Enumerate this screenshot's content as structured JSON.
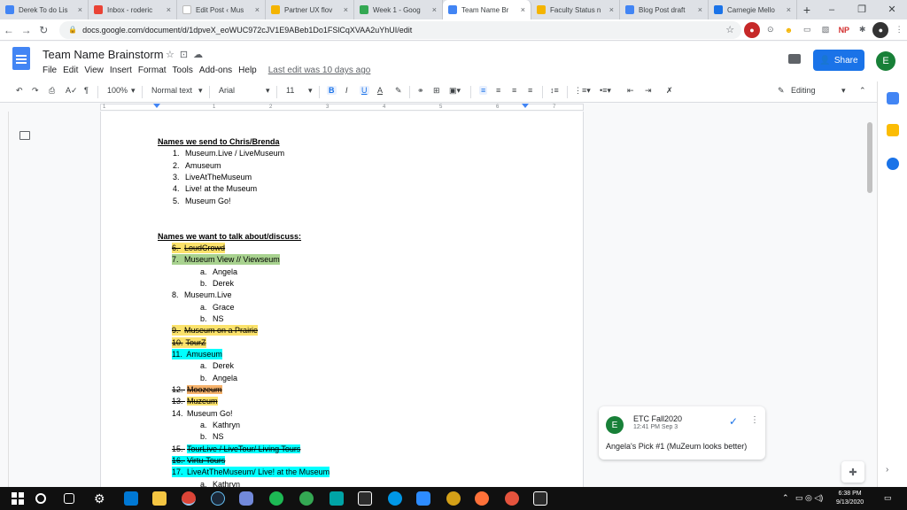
{
  "browser": {
    "tabs": [
      {
        "label": "Derek To do Lis",
        "color": "#4285f4",
        "active": false
      },
      {
        "label": "Inbox - roderic",
        "color": "#ea4335",
        "active": false
      },
      {
        "label": "Edit Post ‹ Mus",
        "color": "#ffffff",
        "active": false
      },
      {
        "label": "Partner UX flov",
        "color": "#f4b400",
        "active": false
      },
      {
        "label": "Week 1 - Goog",
        "color": "#34a853",
        "active": false
      },
      {
        "label": "Team Name Br",
        "color": "#4285f4",
        "active": true
      },
      {
        "label": "Faculty Status n",
        "color": "#f4b400",
        "active": false
      },
      {
        "label": "Blog Post draft",
        "color": "#4285f4",
        "active": false
      },
      {
        "label": "Carnegie Mello",
        "color": "#1a73e8",
        "active": false
      }
    ],
    "tab_close": "×",
    "new_tab": "+",
    "window_controls": {
      "minimize": "–",
      "restore": "❐",
      "close": "✕"
    },
    "url": "docs.google.com/document/d/1dpveX_eoWUC972cJV1E9ABeb1Do1FSlCqXVAA2uYhUI/edit",
    "extensions": [
      "NP"
    ]
  },
  "doc": {
    "title": "Team Name Brainstorm",
    "menu": [
      "File",
      "Edit",
      "View",
      "Insert",
      "Format",
      "Tools",
      "Add-ons",
      "Help"
    ],
    "last_edit": "Last edit was 10 days ago",
    "share_label": "Share",
    "user_initial": "E"
  },
  "toolbar": {
    "zoom": "100%",
    "style": "Normal text",
    "font": "Arial",
    "size": "11",
    "bold": "B",
    "italic": "I",
    "underline": "U",
    "text_color": "A",
    "mode": "Editing"
  },
  "ruler": {
    "numbers": [
      "1",
      "1",
      "2",
      "3",
      "4",
      "5",
      "6",
      "7"
    ]
  },
  "content": {
    "section1_header": "Names we send to Chris/Brenda",
    "section1": [
      {
        "n": "1.",
        "text": "Museum.Live / LiveMuseum"
      },
      {
        "n": "2.",
        "text": "Amuseum"
      },
      {
        "n": "3.",
        "text": "LiveAtTheMuseum"
      },
      {
        "n": "4.",
        "text": "Live! at the Museum"
      },
      {
        "n": "5.",
        "text": "Museum Go!"
      }
    ],
    "section2_header": "Names we want to talk about/discuss:",
    "section2": [
      {
        "n": "6.",
        "text": "LoudCrowd"
      },
      {
        "n": "7.",
        "text": "Museum View // Viewseum"
      },
      {
        "n": "a.",
        "text": "Angela"
      },
      {
        "n": "b.",
        "text": "Derek"
      },
      {
        "n": "8.",
        "text": "Museum.Live"
      },
      {
        "n": "a.",
        "text": "Grace"
      },
      {
        "n": "b.",
        "text": "NS"
      },
      {
        "n": "9.",
        "text": "Museum on a Prairie"
      },
      {
        "n": "10.",
        "text": "TourZ"
      },
      {
        "n": "11.",
        "text": "Amuseum"
      },
      {
        "n": "a.",
        "text": "Derek"
      },
      {
        "n": "b.",
        "text": "Angela"
      },
      {
        "n": "12.",
        "text": "Moozeum"
      },
      {
        "n": "13.",
        "text": "Muzeum"
      },
      {
        "n": "14.",
        "text": "Museum Go!"
      },
      {
        "n": "a.",
        "text": "Kathryn"
      },
      {
        "n": "b.",
        "text": "NS"
      },
      {
        "n": "15.",
        "text": "TourLive / LiveTour/ Living Tours"
      },
      {
        "n": "16.",
        "text": "Virtu-Tours"
      },
      {
        "n": "17.",
        "text": "LiveAtTheMuseum/ Live! at the Museum"
      },
      {
        "n": "a.",
        "text": "Kathryn"
      }
    ]
  },
  "comment": {
    "author": "ETC Fall2020",
    "time": "12:41 PM Sep 3",
    "text": "Angela's Pick #1 (MuZeum looks better)",
    "initial": "E",
    "resolve": "✓",
    "more": "⋮"
  },
  "taskbar": {
    "time": "6:38 PM",
    "date": "9/13/2020"
  }
}
